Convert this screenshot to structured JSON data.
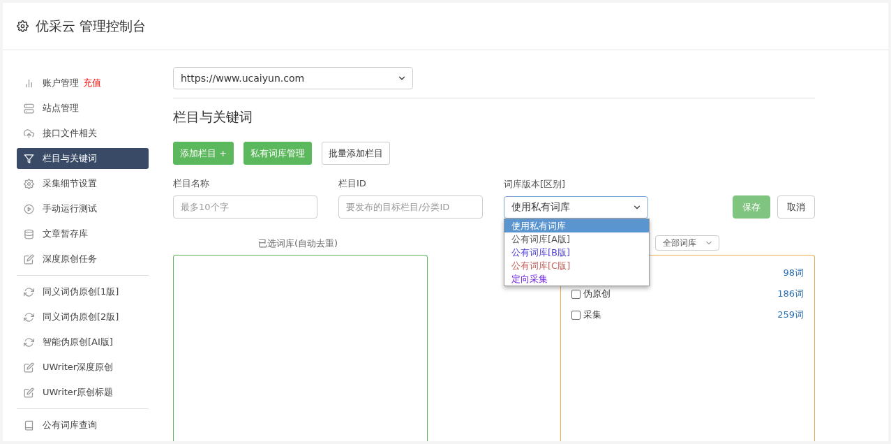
{
  "header": {
    "title": "优采云 管理控制台"
  },
  "sidebar": {
    "groups": [
      {
        "items": [
          {
            "label": "账户管理",
            "badge": "充值",
            "selected": false
          },
          {
            "label": "站点管理",
            "selected": false
          },
          {
            "label": "接口文件相关",
            "selected": false
          },
          {
            "label": "栏目与关键词",
            "selected": true
          },
          {
            "label": "采集细节设置",
            "selected": false
          },
          {
            "label": "手动运行测试",
            "selected": false
          },
          {
            "label": "文章暂存库",
            "selected": false
          },
          {
            "label": "深度原创任务",
            "selected": false
          }
        ]
      },
      {
        "items": [
          {
            "label": "同义词伪原创[1版]",
            "selected": false
          },
          {
            "label": "同义词伪原创[2版]",
            "selected": false
          },
          {
            "label": "智能伪原创[AI版]",
            "selected": false
          },
          {
            "label": "UWriter深度原创",
            "selected": false
          },
          {
            "label": "UWriter原创标题",
            "selected": false
          }
        ]
      },
      {
        "items": [
          {
            "label": "公有词库查询",
            "selected": false
          }
        ]
      }
    ]
  },
  "main": {
    "site_select": {
      "value": "https://www.ucaiyun.com"
    },
    "heading": "栏目与关键词",
    "buttons": [
      {
        "label": "添加栏目 +",
        "kind": "primary"
      },
      {
        "label": "私有词库管理",
        "kind": "primary"
      },
      {
        "label": "批量添加栏目",
        "kind": "default"
      }
    ],
    "form": {
      "name": {
        "label": "栏目名称",
        "placeholder": "最多10个字"
      },
      "id": {
        "label": "栏目ID",
        "placeholder": "要发布的目标栏目/分类ID"
      },
      "version": {
        "label": "词库版本[区别]",
        "value": "使用私有词库",
        "options": [
          {
            "label": "使用私有词库",
            "selected": true
          },
          {
            "label": "公有词库[A版]",
            "selected": false
          },
          {
            "label": "公有词库[B版]",
            "selected": false
          },
          {
            "label": "公有词库[C版]",
            "selected": false
          },
          {
            "label": "定向采集",
            "selected": false
          }
        ]
      },
      "save": "保存",
      "cancel": "取消"
    },
    "selected_label": "已选词库(自动去重)",
    "filter": {
      "value": "全部词库"
    },
    "libraries": [
      {
        "count": "98词"
      },
      {
        "label": "伪原创",
        "count": "186词",
        "checked": false
      },
      {
        "label": "采集",
        "count": "259词",
        "checked": false
      }
    ]
  }
}
